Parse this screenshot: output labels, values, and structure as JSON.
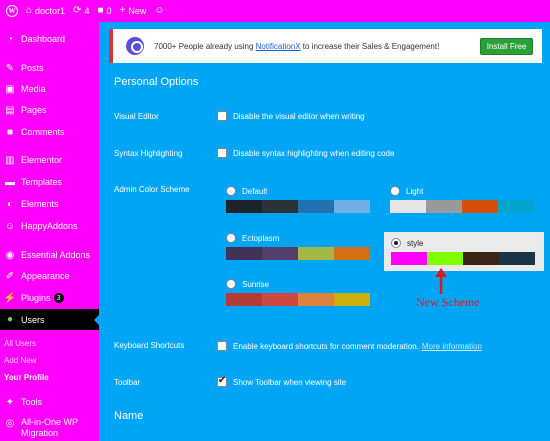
{
  "adminbar": {
    "site_name": "doctor1",
    "updates_count": "4",
    "comments_count": "0",
    "new_label": "New"
  },
  "sidebar": {
    "items": [
      {
        "label": "Dashboard",
        "icon": "dashboard-icon"
      },
      {
        "label": "Posts",
        "icon": "pin-icon"
      },
      {
        "label": "Media",
        "icon": "media-icon"
      },
      {
        "label": "Pages",
        "icon": "pages-icon"
      },
      {
        "label": "Comments",
        "icon": "comment-icon"
      },
      {
        "label": "Elementor",
        "icon": "elementor-icon"
      },
      {
        "label": "Templates",
        "icon": "folder-icon"
      },
      {
        "label": "Elements",
        "icon": "elements-icon"
      },
      {
        "label": "HappyAddons",
        "icon": "happyaddons-icon"
      },
      {
        "label": "Essential Addons",
        "icon": "essential-addons-icon"
      },
      {
        "label": "Appearance",
        "icon": "brush-icon"
      },
      {
        "label": "Plugins",
        "icon": "plugin-icon",
        "badge": "3"
      },
      {
        "label": "Users",
        "icon": "users-icon"
      },
      {
        "label": "Tools",
        "icon": "wrench-icon"
      },
      {
        "label": "All-in-One WP Migration",
        "icon": "migration-icon"
      }
    ],
    "submenu": [
      "All Users",
      "Add New",
      "Your Profile"
    ]
  },
  "notice": {
    "text_before": "7000+ People already using ",
    "link": "NotificationX",
    "text_after": " to increase their Sales & Engagement!",
    "button": "Install Free"
  },
  "main": {
    "personal_options_title": "Personal Options",
    "visual_editor_label": "Visual Editor",
    "visual_editor_option": "Disable the visual editor when writing",
    "syntax_label": "Syntax Highlighting",
    "syntax_option": "Disable syntax highlighting when editing code",
    "color_scheme_label": "Admin Color Scheme",
    "schemes": [
      {
        "name": "Default",
        "colors": [
          "#1d2327",
          "#2c3338",
          "#2271b1",
          "#72aee6"
        ],
        "checked": false
      },
      {
        "name": "Light",
        "colors": [
          "#e5e5e5",
          "#999999",
          "#d64e07",
          "#04a4cc"
        ],
        "checked": false
      },
      {
        "name": "Ectoplasm",
        "colors": [
          "#413256",
          "#523f6d",
          "#a3b745",
          "#d46f15"
        ],
        "checked": false
      },
      {
        "name": "style",
        "colors": [
          "#ff00ff",
          "#80ff00",
          "#3a2418",
          "#1c3245"
        ],
        "checked": true
      },
      {
        "name": "Sunrise",
        "colors": [
          "#b43c38",
          "#cf4944",
          "#dd823b",
          "#ccaf0b"
        ],
        "checked": false
      }
    ],
    "keyboard_label": "Keyboard Shortcuts",
    "keyboard_option": "Enable keyboard shortcuts for comment moderation.",
    "keyboard_more": "More information",
    "toolbar_label": "Toolbar",
    "toolbar_option": "Show Toolbar when viewing site",
    "name_title": "Name"
  },
  "annotation": {
    "text": "New Scheme",
    "color": "#e0161b"
  }
}
